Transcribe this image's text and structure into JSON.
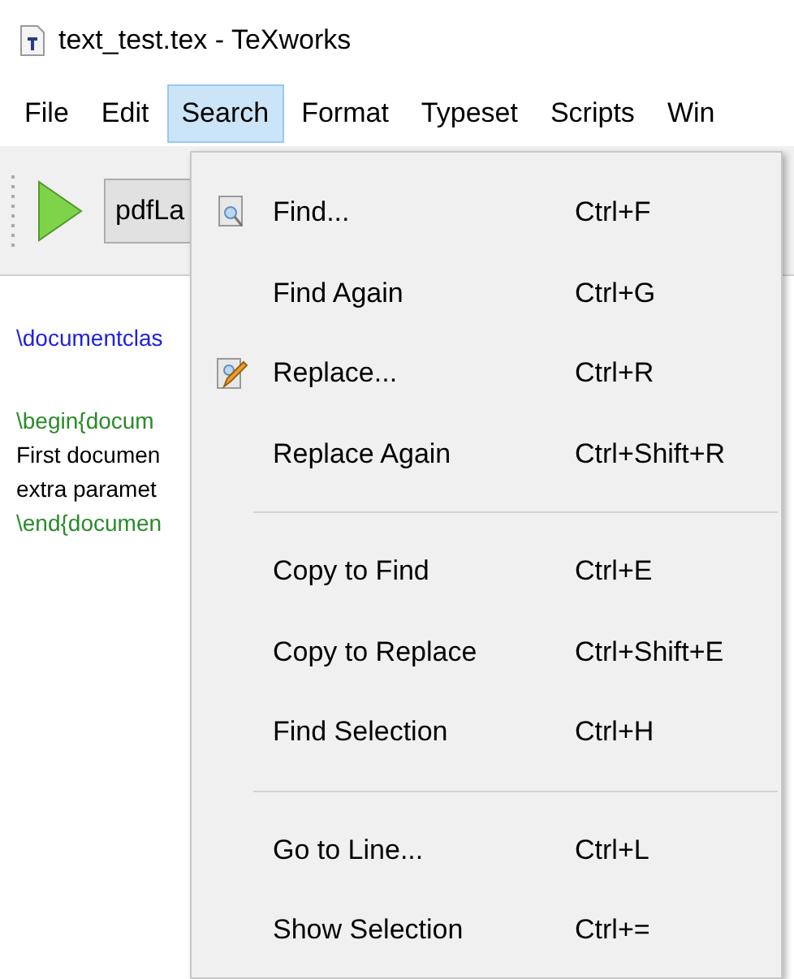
{
  "window": {
    "title": "text_test.tex - TeXworks"
  },
  "menu_bar": [
    {
      "label": "File",
      "selected": false
    },
    {
      "label": "Edit",
      "selected": false
    },
    {
      "label": "Search",
      "selected": true
    },
    {
      "label": "Format",
      "selected": false
    },
    {
      "label": "Typeset",
      "selected": false
    },
    {
      "label": "Scripts",
      "selected": false
    },
    {
      "label": "Win",
      "selected": false
    }
  ],
  "toolbar": {
    "engine": "pdfLa"
  },
  "editor": {
    "lines": [
      {
        "text": "\\documentclas",
        "kind": "command"
      },
      {
        "kind": "blank"
      },
      {
        "text": "\\begin{docum",
        "kind": "environment"
      },
      {
        "text": "First documen",
        "kind": "plain"
      },
      {
        "text": "extra paramet",
        "kind": "plain"
      },
      {
        "text": "\\end{documen",
        "kind": "environment"
      }
    ]
  },
  "search_menu": [
    {
      "kind": "find",
      "label": "Find...",
      "shortcut": "Ctrl+F"
    },
    {
      "kind": "item",
      "label": "Find Again",
      "shortcut": "Ctrl+G"
    },
    {
      "kind": "replace",
      "label": "Replace...",
      "shortcut": "Ctrl+R"
    },
    {
      "kind": "item",
      "label": "Replace Again",
      "shortcut": "Ctrl+Shift+R"
    },
    {
      "kind": "separator"
    },
    {
      "kind": "item",
      "label": "Copy to Find",
      "shortcut": "Ctrl+E"
    },
    {
      "kind": "item",
      "label": "Copy to Replace",
      "shortcut": "Ctrl+Shift+E"
    },
    {
      "kind": "item",
      "label": "Find Selection",
      "shortcut": "Ctrl+H"
    },
    {
      "kind": "separator"
    },
    {
      "kind": "item",
      "label": "Go to Line...",
      "shortcut": "Ctrl+L"
    },
    {
      "kind": "item",
      "label": "Show Selection",
      "shortcut": "Ctrl+="
    }
  ]
}
